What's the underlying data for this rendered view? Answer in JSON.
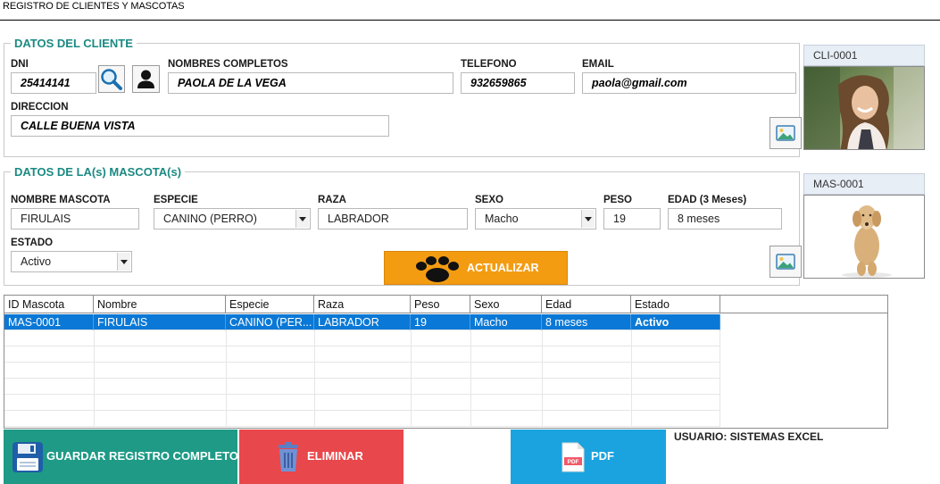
{
  "window": {
    "title": "REGISTRO DE CLIENTES Y MASCOTAS"
  },
  "cliente": {
    "section_title": "DATOS DEL CLIENTE",
    "dni_label": "DNI",
    "dni": "25414141",
    "nombres_label": "NOMBRES COMPLETOS",
    "nombres": "PAOLA DE LA VEGA",
    "telefono_label": "TELEFONO",
    "telefono": "932659865",
    "email_label": "EMAIL",
    "email": "paola@gmail.com",
    "direccion_label": "DIRECCION",
    "direccion": "CALLE BUENA VISTA",
    "photo_code": "CLI-0001"
  },
  "mascota": {
    "section_title": "DATOS DE LA(s) MASCOTA(s)",
    "nombre_label": "NOMBRE MASCOTA",
    "nombre": "FIRULAIS",
    "especie_label": "ESPECIE",
    "especie": "CANINO (PERRO)",
    "raza_label": "RAZA",
    "raza": "LABRADOR",
    "sexo_label": "SEXO",
    "sexo": "Macho",
    "peso_label": "PESO",
    "peso": "19",
    "edad_label": "EDAD (3 Meses)",
    "edad": "8 meses",
    "estado_label": "ESTADO",
    "estado": "Activo",
    "photo_code": "MAS-0001",
    "update_button": "ACTUALIZAR"
  },
  "table": {
    "columns": [
      "ID Mascota",
      "Nombre",
      "Especie",
      "Raza",
      "Peso",
      "Sexo",
      "Edad",
      "Estado"
    ],
    "rows": [
      [
        "MAS-0001",
        "FIRULAIS",
        "CANINO (PER...",
        "LABRADOR",
        "19",
        "Macho",
        "8 meses",
        "Activo"
      ]
    ]
  },
  "actions": {
    "save": "GUARDAR REGISTRO COMPLETO",
    "delete": "ELIMINAR",
    "pdf": "PDF",
    "pdf_icon_text": "PDF"
  },
  "status": {
    "user": "USUARIO: SISTEMAS EXCEL"
  },
  "colors": {
    "section_title": "#1a8a82",
    "save_button": "#1e9a86",
    "delete_button": "#e8474b",
    "pdf_button": "#1aa3df",
    "update_button": "#f39c12",
    "selection": "#0a78d6"
  },
  "icons": {
    "search": "search-icon",
    "person": "person-icon",
    "client_image": "image-icon",
    "pet_image": "image-icon",
    "paw": "paw-icon",
    "save": "floppy-disk-icon",
    "delete": "trash-icon",
    "pdf": "pdf-file-icon",
    "dropdown": "chevron-down-icon"
  }
}
